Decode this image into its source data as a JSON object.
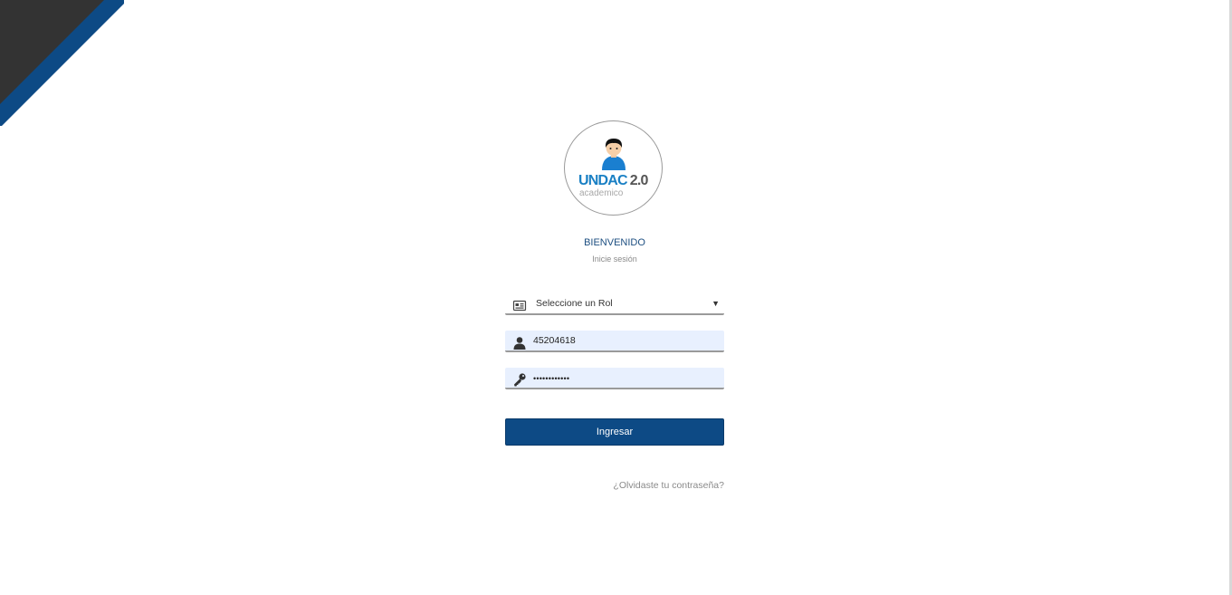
{
  "logo": {
    "brand": "UNDAC",
    "version": "2.0",
    "subtitle": "academico"
  },
  "header": {
    "title": "BIENVENIDO",
    "subtitle": "Inicie sesión"
  },
  "form": {
    "role_select": {
      "selected": "Seleccione un Rol",
      "icon": "id-card-icon"
    },
    "username": {
      "value": "45204618",
      "icon": "user-icon"
    },
    "password": {
      "value": "••••••••••••",
      "icon": "key-icon"
    },
    "submit_label": "Ingresar",
    "forgot_label": "¿Olvidaste tu contraseña?"
  },
  "colors": {
    "primary": "#0d4a85",
    "corner_dark": "#333333",
    "corner_blue": "#0d4a85",
    "brand_blue": "#1a80c4",
    "input_autofill": "#e8f0fe"
  }
}
